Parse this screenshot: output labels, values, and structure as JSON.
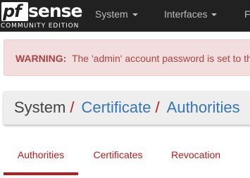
{
  "brand": {
    "logo_prefix": "pf",
    "logo_main": "sense",
    "edition": "COMMUNITY EDITION"
  },
  "nav": {
    "items": [
      {
        "label": "System"
      },
      {
        "label": "Interfaces"
      },
      {
        "label": "F"
      }
    ]
  },
  "alert": {
    "label": "WARNING:",
    "message": "The 'admin' account password is set to the"
  },
  "breadcrumb": {
    "root": "System",
    "separator": "/",
    "items": [
      {
        "label": "Certificate"
      },
      {
        "label": "Authorities"
      }
    ]
  },
  "tabs": {
    "items": [
      {
        "label": "Authorities",
        "active": true
      },
      {
        "label": "Certificates",
        "active": false
      },
      {
        "label": "Revocation",
        "active": false
      }
    ]
  },
  "colors": {
    "navbar": "#212121",
    "accent": "#b71c1c",
    "link": "#3676b5",
    "alert_bg": "#f2dede",
    "alert_text": "#a94442"
  }
}
